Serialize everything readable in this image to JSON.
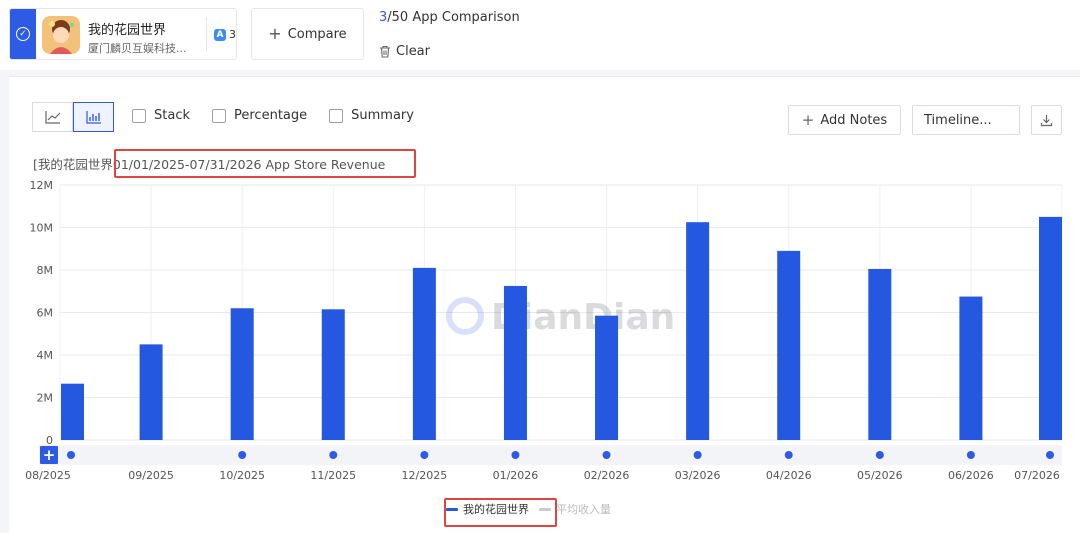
{
  "app": {
    "name": "我的花园世界",
    "publisher": "厦门麟贝互娱科技...",
    "store_count": "3"
  },
  "toolbar": {
    "compare_label": "Compare",
    "compare_current": "3",
    "compare_rest": "/50 App Comparison",
    "clear_label": "Clear",
    "stack_label": "Stack",
    "percentage_label": "Percentage",
    "summary_label": "Summary",
    "add_notes_label": "Add Notes",
    "timeline_label": "Timeline..."
  },
  "chart_title": {
    "app_part": "[我的花园世界",
    "range_part": "01/01/2025-07/31/2026 App Store Revenue"
  },
  "watermark": "DianDian",
  "colors": {
    "accent": "#2e5be6",
    "bar": "#2458e0",
    "highlight": "#e0443e"
  },
  "chart_data": {
    "type": "bar",
    "title": "[我的花园世界01/01/2025-07/31/2026 App Store Revenue",
    "categories": [
      "08/2025",
      "09/2025",
      "10/2025",
      "11/2025",
      "12/2025",
      "01/2026",
      "02/2026",
      "03/2026",
      "04/2026",
      "05/2026",
      "06/2026",
      "07/2026"
    ],
    "series": [
      {
        "name": "我的花园世界",
        "values": [
          2.65,
          4.5,
          6.2,
          6.15,
          8.1,
          7.25,
          5.85,
          10.25,
          8.9,
          8.05,
          6.75,
          10.5
        ]
      }
    ],
    "y_unit": "M",
    "ylim": [
      0,
      12
    ],
    "yticks": [
      0,
      2,
      4,
      6,
      8,
      10,
      12
    ],
    "ytick_labels": [
      "0",
      "2M",
      "4M",
      "6M",
      "8M",
      "10M",
      "12M"
    ],
    "grid": true,
    "legend": [
      "我的花园世界",
      "平均收入量"
    ],
    "legend_position": "bottom-center"
  }
}
